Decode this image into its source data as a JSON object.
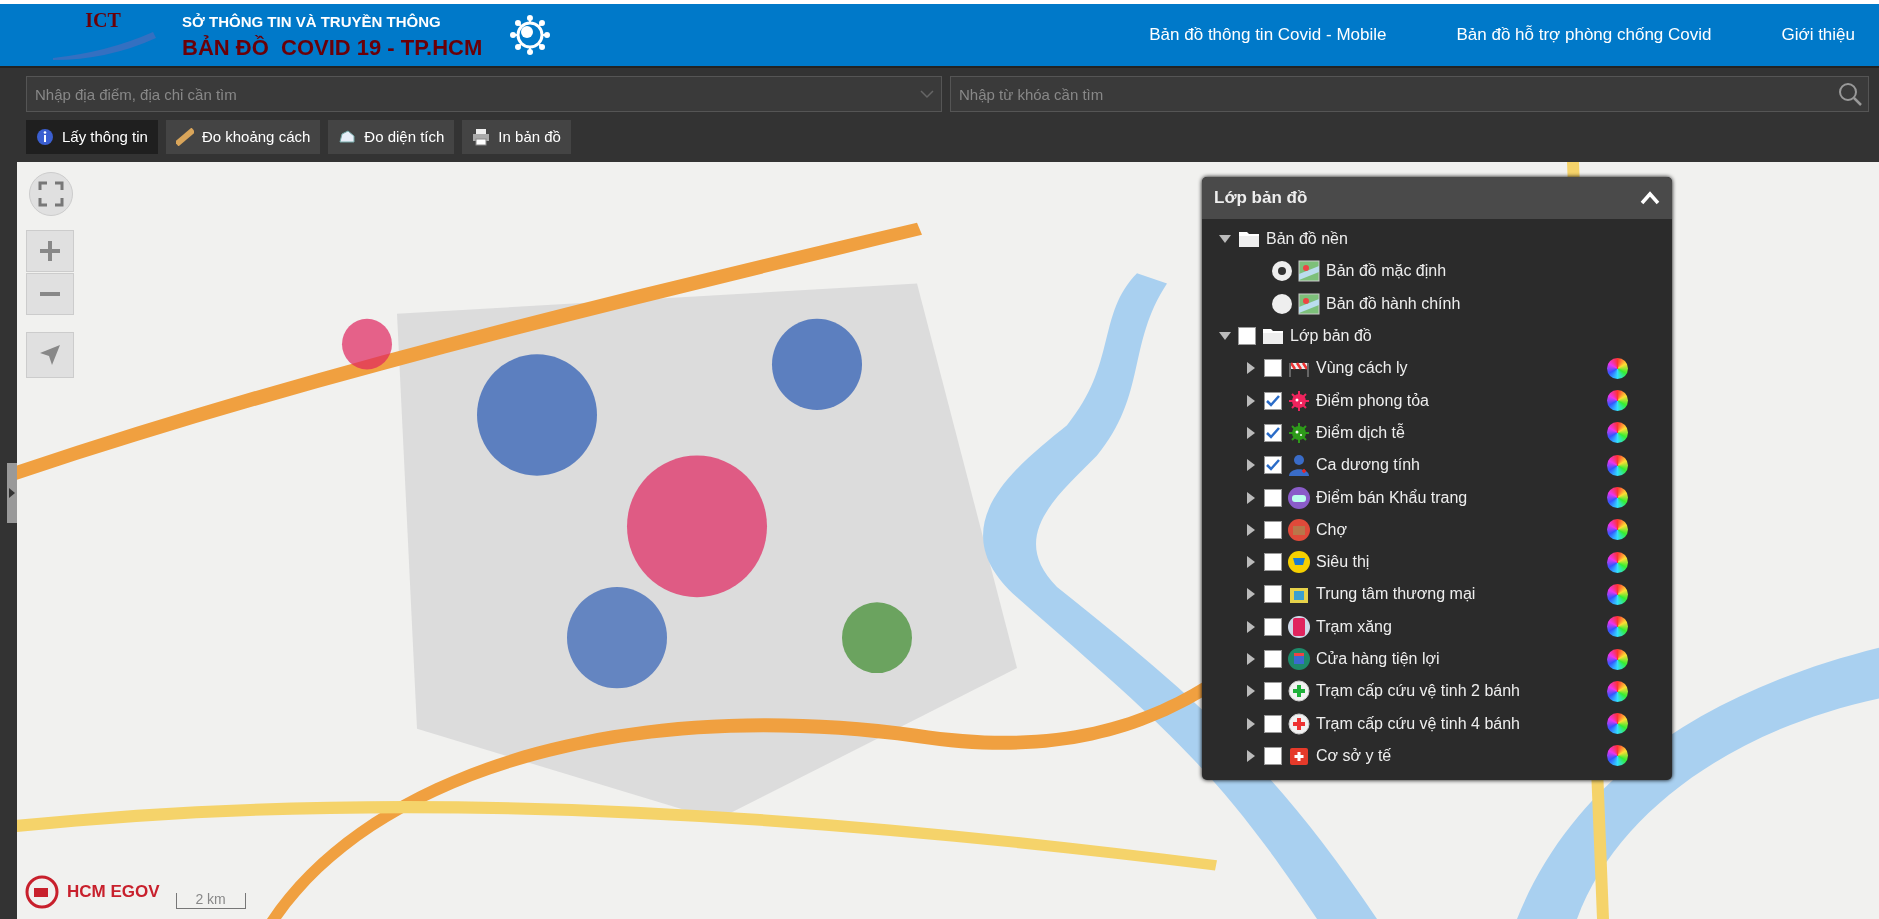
{
  "header": {
    "logo": "ICT",
    "org": "SỞ THÔNG TIN VÀ TRUYỀN THÔNG",
    "title": "BẢN ĐỒ  COVID 19 - TP.HCM",
    "nav": [
      {
        "label": "Bản đồ thông tin Covid - Mobile"
      },
      {
        "label": "Bản đồ hỗ trợ phòng chống Covid"
      },
      {
        "label": "Giới thiệu"
      }
    ]
  },
  "search": {
    "address_placeholder": "Nhập địa điểm, địa chỉ cần tìm",
    "keyword_placeholder": "Nhập từ khóa cần tìm"
  },
  "tools": [
    {
      "label": "Lấy thông tin",
      "selected": true
    },
    {
      "label": "Đo khoảng cách",
      "selected": false
    },
    {
      "label": "Đo diện tích",
      "selected": false
    },
    {
      "label": "In bản đồ",
      "selected": false
    }
  ],
  "map": {
    "kind": "picture",
    "scale": "2 km",
    "brand": "HCM EGOV"
  },
  "layer_panel": {
    "title": "Lớp bản đồ",
    "expanded": true,
    "tree": [
      {
        "kind": "folder",
        "label": "Bản đồ nền",
        "expanded": true,
        "children": [
          {
            "kind": "basemap",
            "label": "Bản đồ mặc định",
            "selected": true
          },
          {
            "kind": "basemap",
            "label": "Bản đồ hành chính",
            "selected": false
          }
        ]
      },
      {
        "kind": "folder",
        "label": "Lớp bản đồ",
        "expanded": true,
        "checked": false,
        "children": [
          {
            "kind": "layer",
            "label": "Vùng cách ly",
            "expanded": false,
            "checked": false
          },
          {
            "kind": "layer",
            "label": "Điểm phong tỏa",
            "expanded": false,
            "checked": true
          },
          {
            "kind": "layer",
            "label": "Điểm dịch tễ",
            "expanded": false,
            "checked": true
          },
          {
            "kind": "layer",
            "label": "Ca dương tính",
            "expanded": false,
            "checked": true
          },
          {
            "kind": "layer",
            "label": "Điểm bán Khẩu trang",
            "expanded": false,
            "checked": false
          },
          {
            "kind": "layer",
            "label": "Chợ",
            "expanded": false,
            "checked": false
          },
          {
            "kind": "layer",
            "label": "Siêu thị",
            "expanded": false,
            "checked": false
          },
          {
            "kind": "layer",
            "label": "Trung tâm thương mại",
            "expanded": false,
            "checked": false
          },
          {
            "kind": "layer",
            "label": "Trạm xăng",
            "expanded": false,
            "checked": false
          },
          {
            "kind": "layer",
            "label": "Cửa hàng tiện lợi",
            "expanded": false,
            "checked": false
          },
          {
            "kind": "layer",
            "label": "Trạm cấp cứu vệ tinh 2 bánh",
            "expanded": false,
            "checked": false
          },
          {
            "kind": "layer",
            "label": "Trạm cấp cứu vệ tinh 4 bánh",
            "expanded": false,
            "checked": false
          },
          {
            "kind": "layer",
            "label": "Cơ sở y tế",
            "expanded": false,
            "checked": false
          }
        ]
      }
    ]
  }
}
